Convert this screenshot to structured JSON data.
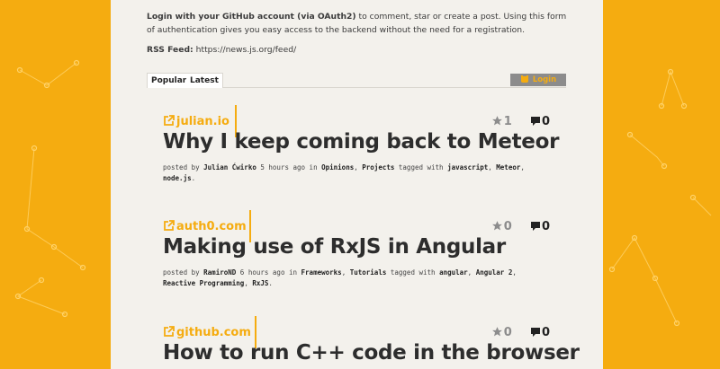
{
  "intro": {
    "bold": "Login with your GitHub account (via OAuth2)",
    "rest": " to comment, star or create a post. Using this form of authentication gives you easy access to the backend without the need for a registration.",
    "rss_label": "RSS Feed:",
    "rss_url": " https://news.js.org/feed/"
  },
  "tabs": {
    "popular": "Popular",
    "latest": "Latest"
  },
  "login": {
    "label": "Login"
  },
  "colors": {
    "accent": "#f5ac10",
    "page_bg": "#f3f1ec",
    "grey": "#8c8c8c"
  },
  "posts": [
    {
      "domain": "julian.io",
      "stars": "1",
      "comments": "0",
      "title": "Why I keep coming back to Meteor",
      "meta": {
        "posted_by": "posted by",
        "author": "Julian Ćwirko",
        "time": " 5 hours ago in ",
        "cat1": "Opinions",
        "sep1": ", ",
        "cat2": "Projects",
        "tagged": " tagged with ",
        "tag1": "javascript",
        "sep2": ", ",
        "tag2": "Meteor",
        "sep3": ", ",
        "tag3": "node.js",
        "end": "."
      }
    },
    {
      "domain": "auth0.com",
      "stars": "0",
      "comments": "0",
      "title": "Making use of RxJS in Angular",
      "meta": {
        "posted_by": "posted by",
        "author": "RamiroND",
        "time": " 6 hours ago in ",
        "cat1": "Frameworks",
        "sep1": ", ",
        "cat2": "Tutorials",
        "tagged": " tagged with ",
        "tag1": "angular",
        "sep2": ", ",
        "tag2": "Angular 2",
        "sep3": ", ",
        "tag3": "Reactive Programming",
        "sep4": ", ",
        "tag4": "RxJS",
        "end": "."
      }
    },
    {
      "domain": "github.com",
      "stars": "0",
      "comments": "0",
      "title": "How to run C++ code in the browser"
    }
  ]
}
